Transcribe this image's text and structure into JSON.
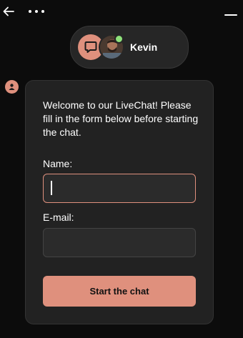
{
  "header": {
    "back_icon": "arrow-left-icon",
    "more_icon": "more-horizontal-icon",
    "minimize_icon": "minimize-icon"
  },
  "agent": {
    "name": "Kevin",
    "status": "online",
    "status_color": "#8ee27a"
  },
  "form": {
    "welcome_message": "Welcome to our LiveChat! Please fill in the form below before starting the chat.",
    "name_label": "Name:",
    "name_value": "",
    "email_label": "E-mail:",
    "email_value": "",
    "submit_label": "Start the chat"
  },
  "colors": {
    "accent": "#df907d",
    "background": "#0c0c0c",
    "card": "#222222"
  }
}
